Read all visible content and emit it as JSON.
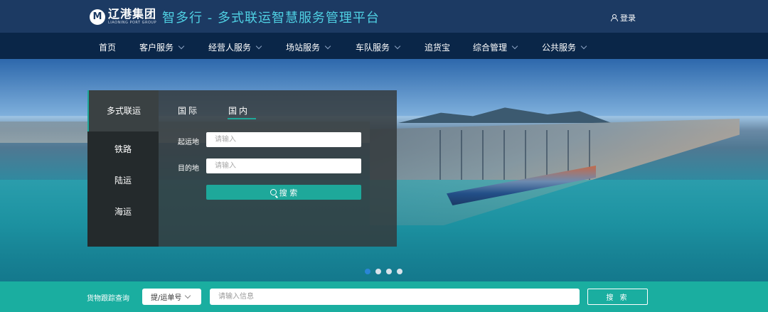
{
  "header": {
    "logo_cn": "辽港集团",
    "logo_en": "LIAONING PORT GROUP",
    "platform_title": "智多行 - 多式联运智慧服务管理平台",
    "login_label": "登录"
  },
  "nav": {
    "items": [
      {
        "label": "首页",
        "has_dropdown": false
      },
      {
        "label": "客户服务",
        "has_dropdown": true
      },
      {
        "label": "经营人服务",
        "has_dropdown": true
      },
      {
        "label": "场站服务",
        "has_dropdown": true
      },
      {
        "label": "车队服务",
        "has_dropdown": true
      },
      {
        "label": "追货宝",
        "has_dropdown": false
      },
      {
        "label": "综合管理",
        "has_dropdown": true
      },
      {
        "label": "公共服务",
        "has_dropdown": true
      }
    ]
  },
  "search_panel": {
    "side_items": [
      "多式联运",
      "铁路",
      "陆运",
      "海运"
    ],
    "active_side": "多式联运",
    "tabs": [
      "国际",
      "国内"
    ],
    "active_tab": "国内",
    "origin_label": "起运地",
    "origin_placeholder": "请输入",
    "destination_label": "目的地",
    "destination_placeholder": "请输入",
    "search_button": "搜 索"
  },
  "carousel": {
    "slide_count": 4,
    "active_index": 0
  },
  "tracking": {
    "label": "货物跟踪查询",
    "type_select": "提/运单号",
    "input_placeholder": "请输入信息",
    "search_button": "搜 索"
  },
  "colors": {
    "header_bg": "#1c3a63",
    "nav_bg": "#0a2648",
    "accent": "#1ea89a",
    "title_text": "#4fd0e3"
  }
}
